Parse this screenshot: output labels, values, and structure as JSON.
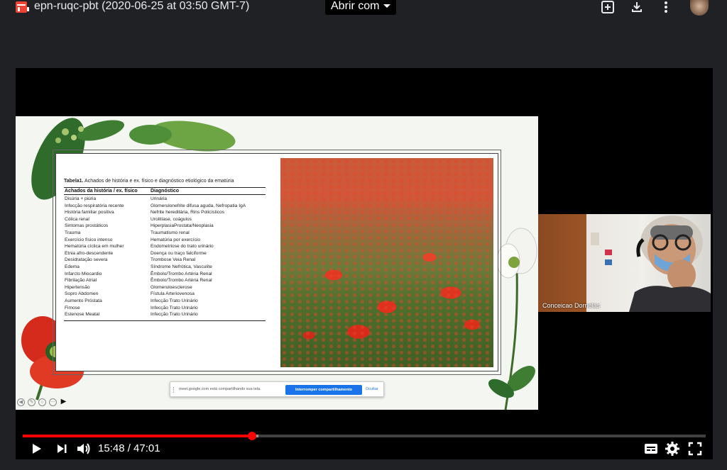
{
  "top_bar": {
    "file_title": "epn-ruqc-pbt (2020-06-25 at 03:50 GMT-7)",
    "open_with_label": "Abrir com",
    "icons": [
      "file-video-icon",
      "add-to-drive-icon",
      "download-icon",
      "more-vert-icon",
      "avatar"
    ]
  },
  "slide": {
    "table_title_bold": "Tabela1.",
    "table_title_rest": " Achados de história e ex. físico e diagnóstico etiológico da ematúria",
    "col_headers": [
      "Achados da história / ex. físico",
      "Diagnóstico"
    ],
    "rows": [
      [
        "Disúria + piúria",
        "Urinária"
      ],
      [
        "Infecção respiratória recente",
        "Glomerulonefrite difusa aguda, Nefropatia IgA"
      ],
      [
        "História familiar positiva",
        "Nefrite hereditária, Rins Policísticos"
      ],
      [
        "Cólica renal",
        "Urolitíase, coágulos"
      ],
      [
        "Sintomas prostáticos",
        "HiperplasiaProstata/Neoplasia"
      ],
      [
        "Trauma",
        "Traumatismo renal"
      ],
      [
        "Exercício físico intenso",
        "Hematúria por exercício"
      ],
      [
        "Hematúria cíclica em mulher",
        "Endometriose do trato urinário"
      ],
      [
        "Etnia afro-descendente",
        "Doença ou traço falciforme"
      ],
      [
        "Desidratação severa",
        "Trombose Veia Renal"
      ],
      [
        "Edema",
        "Síndrome Nefrótica, Vasculite"
      ],
      [
        "Infarcto Miocardio",
        "Êmbolo/Trombo Artéria Renal"
      ],
      [
        "Fibrilação Atrial",
        "Êmbolo/Trombo Artéria Renal"
      ],
      [
        "Hipertensão",
        "Glomeruloesclerose"
      ],
      [
        "Sopro Abdomen",
        "Fístula Arteriovenosa"
      ],
      [
        "Aumento Próstata",
        "Infecção Trato Urinário"
      ],
      [
        "Fimose",
        "Infecção Trato Urinário"
      ],
      [
        "Estenose Meatal",
        "Infecção Trato Urinário"
      ]
    ],
    "share_notice": {
      "text": "meet.google.com está compartilhando sua tela.",
      "stop_label": "Interromper compartilhamento",
      "hide_label": "Ocultar"
    }
  },
  "webcam": {
    "participant_name": "Conceicao Dornelas"
  },
  "player": {
    "current_time": "15:48",
    "duration": "47:01",
    "time_text": "15:48 / 47:01",
    "played_fraction": 0.336,
    "buffered_fraction": 0.345,
    "accent_color": "#ff0000",
    "controls": [
      "play-icon",
      "next-icon",
      "volume-icon",
      "subtitles-icon",
      "settings-icon",
      "fullscreen-icon"
    ]
  }
}
